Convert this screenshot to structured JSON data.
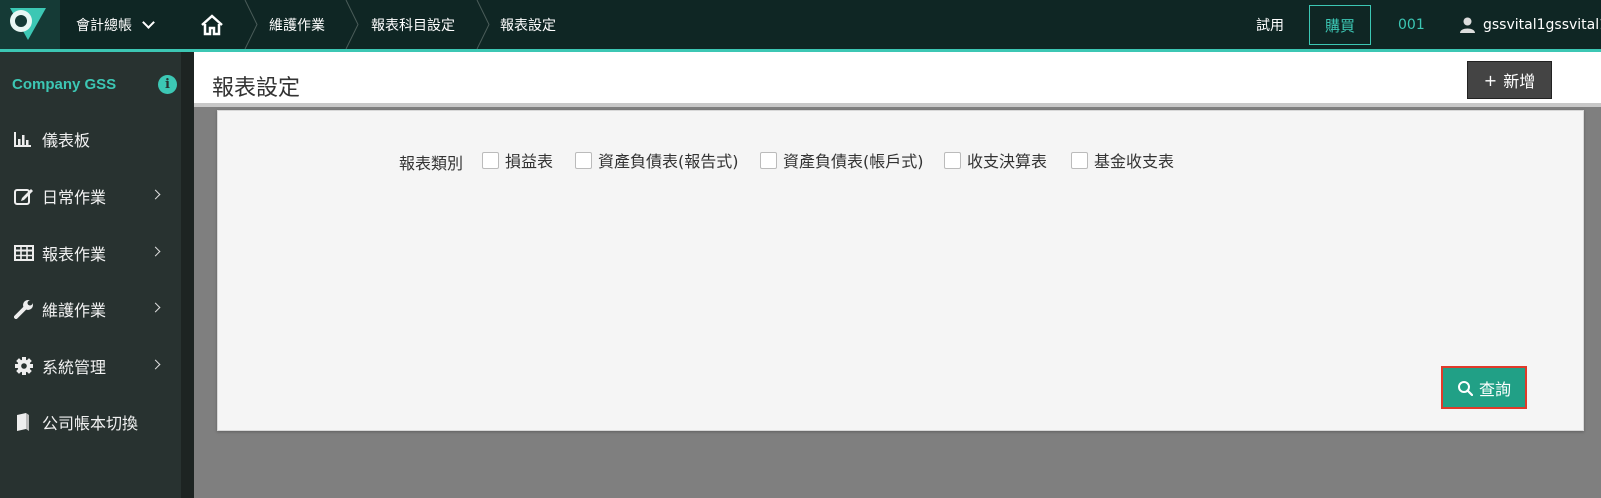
{
  "topbar": {
    "module": "會計總帳",
    "breadcrumbs": [
      "維護作業",
      "報表科目設定",
      "報表設定"
    ],
    "trial": "試用",
    "buy": "購買",
    "code": "001",
    "user": "gssvital1gssvital1"
  },
  "sidebar": {
    "company": "Company GSS",
    "items": [
      {
        "label": "儀表板",
        "icon": "bar-chart-icon",
        "arrow": false
      },
      {
        "label": "日常作業",
        "icon": "edit-icon",
        "arrow": true
      },
      {
        "label": "報表作業",
        "icon": "table-icon",
        "arrow": true
      },
      {
        "label": "維護作業",
        "icon": "wrench-icon",
        "arrow": true
      },
      {
        "label": "系統管理",
        "icon": "gear-icon",
        "arrow": true
      },
      {
        "label": "公司帳本切換",
        "icon": "book-icon",
        "arrow": false
      }
    ]
  },
  "header": {
    "title": "報表設定",
    "add_label": "新增"
  },
  "filter": {
    "label": "報表類別",
    "options": [
      "損益表",
      "資產負債表(報告式)",
      "資產負債表(帳戶式)",
      "收支決算表",
      "基金收支表"
    ]
  },
  "query_label": "查詢",
  "colors": {
    "accent": "#3cc7b4",
    "topbar": "#0f2624",
    "sidebar": "#283230",
    "query_button": "#21a086",
    "highlight_border": "#e03a2a"
  }
}
